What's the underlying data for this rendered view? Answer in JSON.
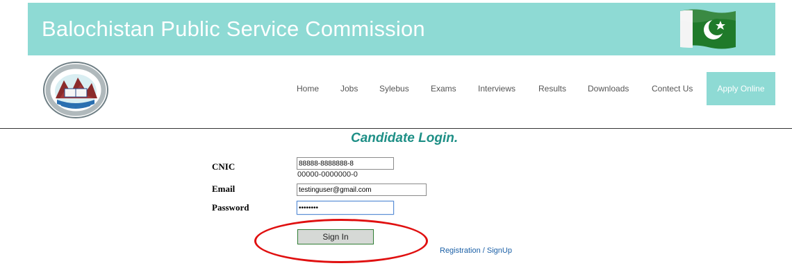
{
  "header": {
    "title": "Balochistan Public Service Commission",
    "flag_icon": "pakistan-flag-icon",
    "logo_icon": "bpsc-emblem-logo"
  },
  "nav": {
    "items": [
      {
        "label": "Home"
      },
      {
        "label": "Jobs"
      },
      {
        "label": "Sylebus"
      },
      {
        "label": "Exams"
      },
      {
        "label": "Interviews"
      },
      {
        "label": "Results"
      },
      {
        "label": "Downloads"
      },
      {
        "label": "Contect Us"
      }
    ],
    "apply_label": "Apply Online"
  },
  "login": {
    "title": "Candidate Login.",
    "cnic_label": "CNIC",
    "cnic_value": "88888-8888888-8",
    "cnic_hint": "00000-0000000-0",
    "email_label": "Email",
    "email_value": "testinguser@gmail.com",
    "password_label": "Password",
    "password_value": "password",
    "signin_label": "Sign In",
    "register_label": "Registration / SignUp"
  },
  "colors": {
    "header_bg": "#8edad4",
    "title_green": "#1e8f86",
    "highlight_red": "#e01010",
    "link_blue": "#1a5fa6"
  }
}
